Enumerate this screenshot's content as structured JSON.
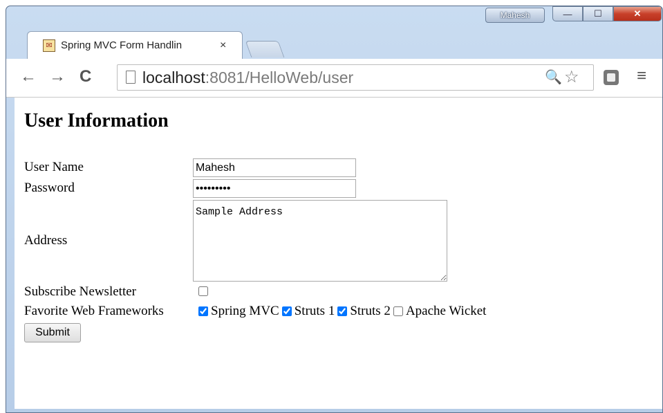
{
  "window": {
    "user_badge": "Mahesh",
    "min_glyph": "—",
    "max_glyph": "☐",
    "close_glyph": "✕"
  },
  "tab": {
    "title": "Spring MVC Form Handlin",
    "close_glyph": "×",
    "favicon_glyph": "✉"
  },
  "toolbar": {
    "back_glyph": "←",
    "forward_glyph": "→",
    "reload_glyph": "C",
    "url_host": "localhost",
    "url_rest": ":8081/HelloWeb/user",
    "zoom_glyph": "🔍",
    "star_glyph": "☆",
    "menu_glyph": "≡"
  },
  "page": {
    "title": "User Information",
    "labels": {
      "username": "User Name",
      "password": "Password",
      "address": "Address",
      "newsletter": "Subscribe Newsletter",
      "frameworks": "Favorite Web Frameworks"
    },
    "username_value": "Mahesh",
    "password_value": "password1",
    "address_value": "Sample Address",
    "newsletter_checked": false,
    "frameworks": [
      {
        "label": "Spring MVC",
        "checked": true
      },
      {
        "label": "Struts 1",
        "checked": true
      },
      {
        "label": "Struts 2",
        "checked": true
      },
      {
        "label": "Apache Wicket",
        "checked": false
      }
    ],
    "submit_label": "Submit"
  }
}
